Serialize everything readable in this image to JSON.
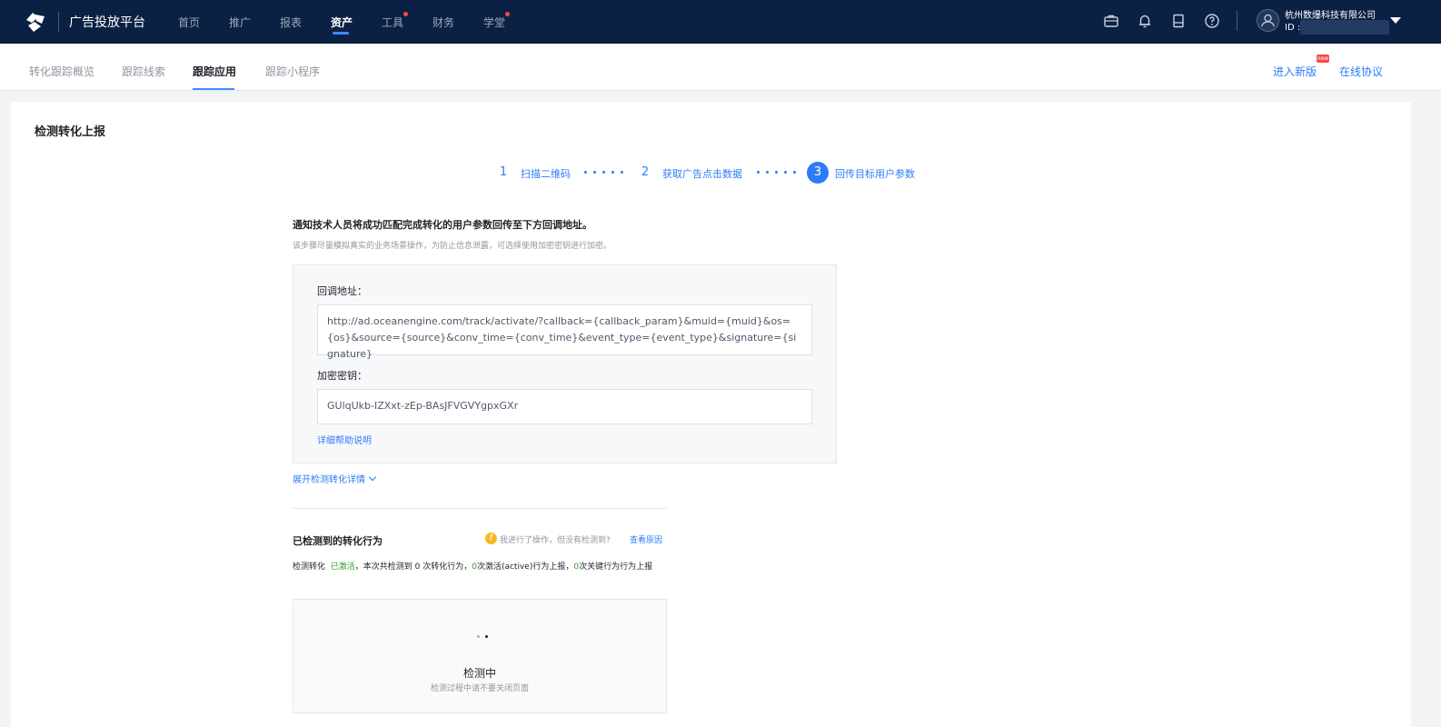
{
  "topbar": {
    "brand": "广告投放平台",
    "nav": [
      {
        "label": "首页"
      },
      {
        "label": "推广"
      },
      {
        "label": "报表"
      },
      {
        "label": "资产",
        "active": true
      },
      {
        "label": "工具",
        "dot": true
      },
      {
        "label": "财务"
      },
      {
        "label": "学堂",
        "dot": true
      }
    ],
    "icons": [
      "briefcase-icon",
      "bell-icon",
      "document-icon",
      "help-icon"
    ],
    "company": "杭州数爆科技有限公司",
    "id_label": "ID :"
  },
  "subnav": {
    "tabs": [
      {
        "label": "转化跟踪概览"
      },
      {
        "label": "跟踪线索"
      },
      {
        "label": "跟踪应用",
        "active": true
      },
      {
        "label": "跟踪小程序"
      }
    ],
    "enter_new": "进入新版",
    "new_badge": "new",
    "protocol": "在线协议"
  },
  "card": {
    "title": "检测转化上报",
    "steps": [
      {
        "num": "1",
        "label": "扫描二维码"
      },
      {
        "num": "2",
        "label": "获取广告点击数据"
      },
      {
        "num": "3",
        "label": "回传目标用户参数",
        "active": true
      }
    ],
    "notice_title": "通知技术人员将成功匹配完成转化的用户参数回传至下方回调地址。",
    "notice_sub": "该步骤尽量模拟真实的业务场景操作，为防止信息泄露，可选择使用加密密钥进行加密。",
    "callback_label": "回调地址：",
    "callback_url": "http://ad.oceanengine.com/track/activate/?callback={callback_param}&muid={muid}&os={os}&source={source}&conv_time={conv_time}&event_type={event_type}&signature={signature}",
    "secret_label": "加密密钥：",
    "secret_value": "GUlqUkb-IZXxt-zEp-BAsJFVGVYgpxGXr",
    "help_link": "详细帮助说明",
    "expand_label": "展开检测转化详情",
    "detected_title": "已检测到的转化行为",
    "warn_text": "我进行了操作，但没有检测到?",
    "reason_link": "查看原因",
    "desc": {
      "prefix": "检测转化",
      "status": "已激活",
      "mid": "，本次共检测到 0 次转化行为，",
      "active_count": "0",
      "active_text": "次激活(active)行为上报，",
      "key_count": "0",
      "key_text": "次关键行为行为上报"
    },
    "status_main": "检测中",
    "status_sub": "检测过程中请不要关闭页面"
  },
  "colors": {
    "topbar_bg": "#0b2143",
    "accent": "#2d7cf6",
    "success": "#2ea121",
    "warning": "#f7ba1e",
    "badge_red": "#f54a45"
  }
}
